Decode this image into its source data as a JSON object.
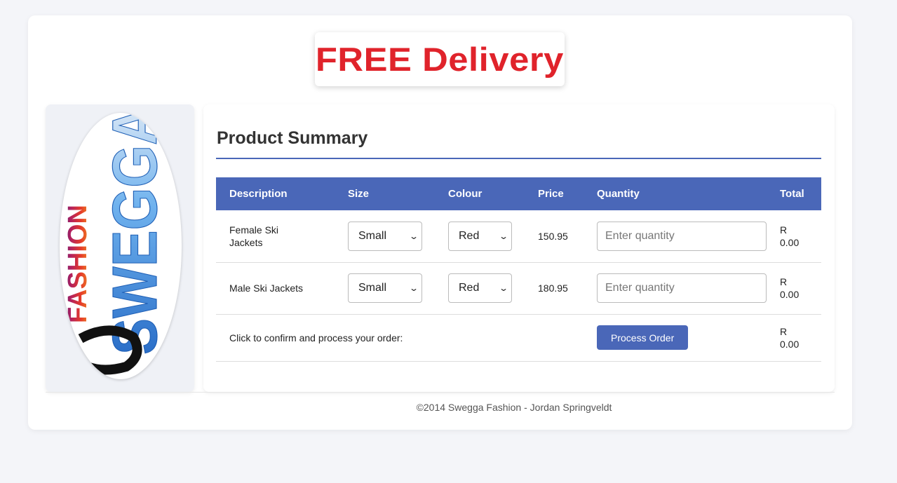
{
  "banner": {
    "text": "FREE Delivery"
  },
  "logo": {
    "brand": "SWEGGA",
    "sub": "FASHION"
  },
  "summary": {
    "title": "Product Summary",
    "columns": [
      "Description",
      "Size",
      "Colour",
      "Price",
      "Quantity",
      "Total"
    ],
    "rows": [
      {
        "description": "Female Ski Jackets",
        "size": "Small",
        "colour": "Red",
        "price": "150.95",
        "quantity_placeholder": "Enter quantity",
        "total_currency": "R",
        "total_value": "0.00"
      },
      {
        "description": "Male Ski Jackets",
        "size": "Small",
        "colour": "Red",
        "price": "180.95",
        "quantity_placeholder": "Enter quantity",
        "total_currency": "R",
        "total_value": "0.00"
      }
    ],
    "confirm_text": "Click to confirm and process your order:",
    "process_button": "Process Order",
    "grand_total_currency": "R",
    "grand_total_value": "0.00"
  },
  "footer": {
    "text": "©2014 Swegga Fashion - Jordan Springveldt"
  },
  "colors": {
    "accent": "#4a67b8",
    "banner_red": "#e0232b"
  },
  "icons": {
    "select_arrow": "chevron-down-icon"
  }
}
